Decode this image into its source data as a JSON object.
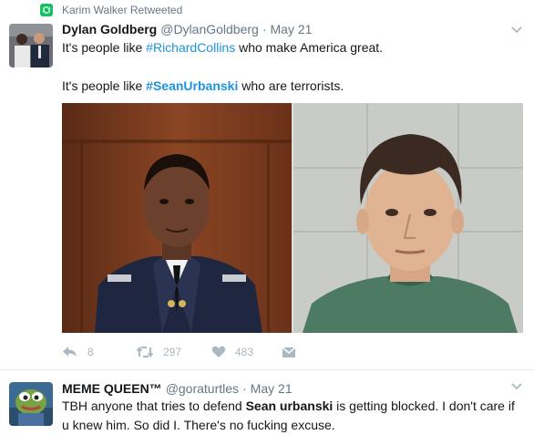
{
  "colors": {
    "link": "#1b95e0",
    "meta": "#657786",
    "action": "#aab8c2",
    "retweet": "#17bf63"
  },
  "tweet1": {
    "retweeted_by": "Karim Walker Retweeted",
    "author_name": "Dylan Goldberg",
    "handle": "@DylanGoldberg",
    "separator": "·",
    "date": "May 21",
    "line1_prefix": "It's people like ",
    "line1_hashtag": "#RichardCollins",
    "line1_suffix": " who make America great.",
    "line2_prefix": "It's people like ",
    "line2_hashtag": "#SeanUrbanski",
    "line2_suffix": " who are terrorists.",
    "icons": {
      "reply": "reply-icon",
      "retweet": "retweet-icon",
      "like": "heart-icon",
      "message": "envelope-icon",
      "menu": "chevron-down-icon"
    },
    "counts": {
      "reply": "8",
      "retweet": "297",
      "like": "483"
    }
  },
  "tweet2": {
    "author_name": "MEME QUEEN™",
    "handle": "@goraturtles",
    "separator": "·",
    "date": "May 21",
    "text_prefix": "TBH anyone that tries to defend ",
    "text_bold": "Sean urbanski",
    "text_suffix": " is getting blocked. I don't care if u knew him. So did I. There's no fucking excuse."
  }
}
